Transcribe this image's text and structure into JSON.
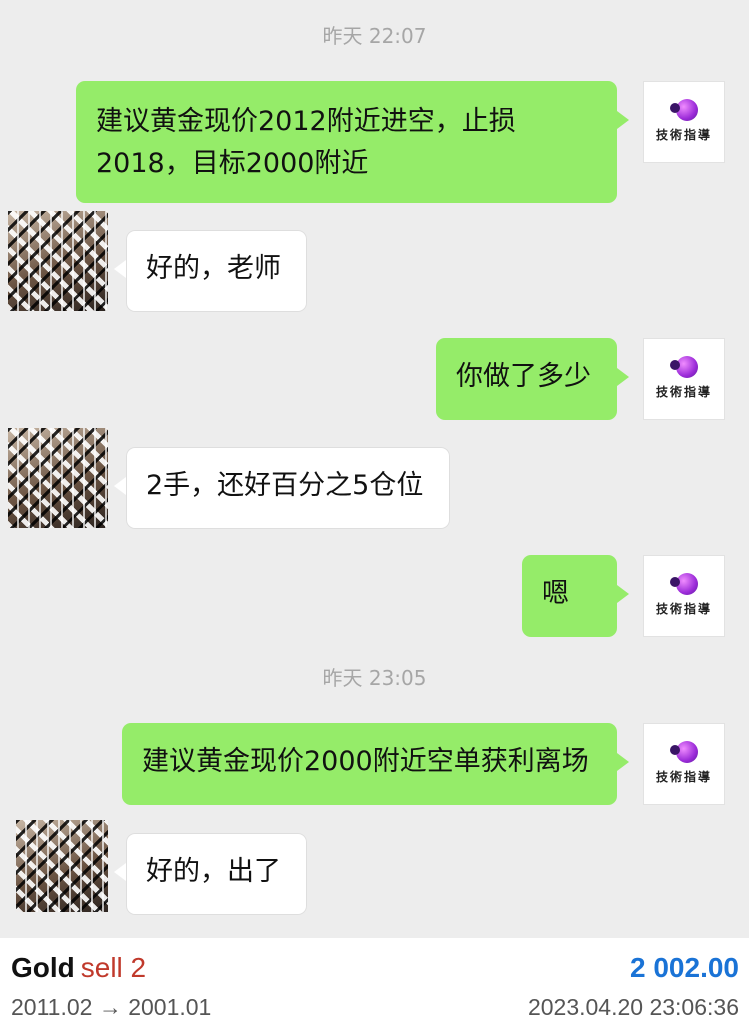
{
  "timestamps": [
    "昨天 22:07",
    "昨天 23:05"
  ],
  "messages": [
    {
      "from": "me",
      "text": "建议黄金现价2012附近进空，止损2018，目标2000附近"
    },
    {
      "from": "them",
      "text": "好的，老师"
    },
    {
      "from": "me",
      "text": "你做了多少"
    },
    {
      "from": "them",
      "text": "2手，还好百分之5仓位"
    },
    {
      "from": "me",
      "text": "嗯"
    },
    {
      "from": "me",
      "text": "建议黄金现价2000附近空单获利离场"
    },
    {
      "from": "them",
      "text": "好的，出了"
    }
  ],
  "self_avatar": {
    "icon": "purple-orb-icon",
    "caption": "技術指導"
  },
  "contact_avatar": {
    "icon": "pixelated-photo"
  },
  "trade": {
    "symbol": "Gold",
    "side": "sell 2",
    "profit": "2 002.00",
    "prices": "2011.02 → 2001.01",
    "time": "2023.04.20 23:06:36"
  },
  "colors": {
    "background": "#ededed",
    "self_bubble": "#95ec69",
    "other_bubble": "#ffffff",
    "sell": "#c0392b",
    "profit": "#1a73d6"
  }
}
